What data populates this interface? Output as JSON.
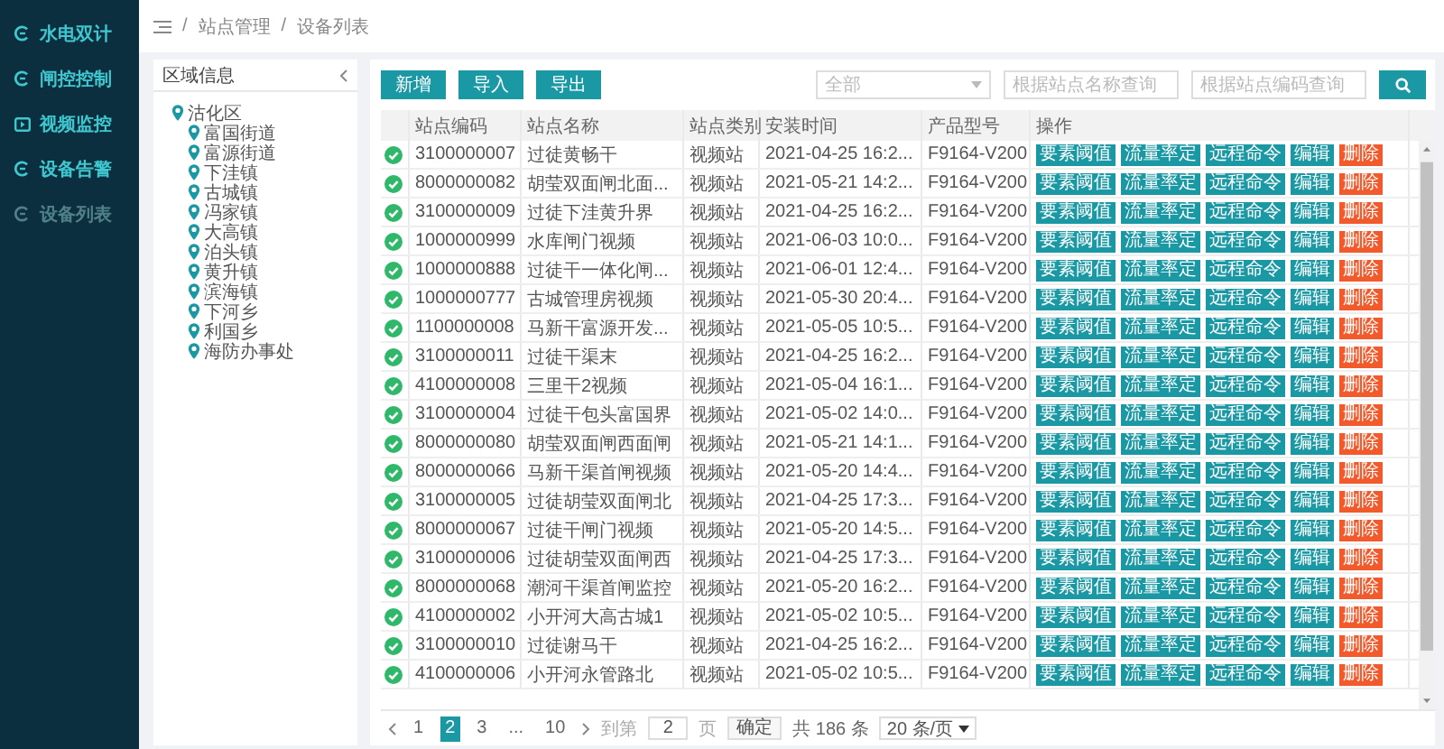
{
  "sidebar": {
    "items": [
      {
        "label": "水电双计",
        "selected": false
      },
      {
        "label": "闸控控制",
        "selected": false
      },
      {
        "label": "视频监控",
        "selected": false
      },
      {
        "label": "设备告警",
        "selected": false
      },
      {
        "label": "设备列表",
        "selected": true
      }
    ]
  },
  "breadcrumb": [
    {
      "separator": "/",
      "label": "站点管理"
    },
    {
      "separator": "/",
      "label": "设备列表"
    }
  ],
  "region_panel": {
    "title": "区域信息",
    "tree": [
      {
        "label": "沽化区",
        "children": [
          {
            "label": "富国街道"
          },
          {
            "label": "富源街道"
          },
          {
            "label": "下洼镇"
          },
          {
            "label": "古城镇"
          },
          {
            "label": "冯家镇"
          },
          {
            "label": "大高镇"
          },
          {
            "label": "泊头镇"
          },
          {
            "label": "黄升镇"
          },
          {
            "label": "滨海镇"
          },
          {
            "label": "下河乡"
          },
          {
            "label": "利国乡"
          },
          {
            "label": "海防办事处"
          }
        ]
      }
    ]
  },
  "toolbar": {
    "buttons": [
      "新增",
      "导入",
      "导出"
    ],
    "type_select": {
      "placeholder": "全部"
    },
    "name_search": {
      "placeholder": "根据站点名称查询"
    },
    "code_search": {
      "placeholder": "根据站点编码查询"
    }
  },
  "table": {
    "columns": [
      "站点编码",
      "站点名称",
      "站点类别",
      "安装时间",
      "产品型号",
      "操作"
    ],
    "rows": [
      {
        "online": true,
        "cells": [
          "3100000007",
          "过徒黄畅干",
          "视频站",
          "2021-04-25 16:2...",
          "F9164-V200"
        ],
        "actions": [
          {
            "label": "要素阈值",
            "kind": "normal"
          },
          {
            "label": "流量率定",
            "kind": "normal"
          },
          {
            "label": "远程命令",
            "kind": "normal"
          },
          {
            "label": "编辑",
            "kind": "normal"
          },
          {
            "label": "删除",
            "kind": "danger"
          }
        ]
      },
      {
        "online": true,
        "cells": [
          "8000000082",
          "胡莹双面闸北面...",
          "视频站",
          "2021-05-21 14:2...",
          "F9164-V200"
        ],
        "actions": [
          {
            "label": "要素阈值",
            "kind": "normal"
          },
          {
            "label": "流量率定",
            "kind": "normal"
          },
          {
            "label": "远程命令",
            "kind": "normal"
          },
          {
            "label": "编辑",
            "kind": "normal"
          },
          {
            "label": "删除",
            "kind": "danger"
          }
        ]
      },
      {
        "online": true,
        "cells": [
          "3100000009",
          "过徒下洼黄升界",
          "视频站",
          "2021-04-25 16:2...",
          "F9164-V200"
        ],
        "actions": [
          {
            "label": "要素阈值",
            "kind": "normal"
          },
          {
            "label": "流量率定",
            "kind": "normal"
          },
          {
            "label": "远程命令",
            "kind": "normal"
          },
          {
            "label": "编辑",
            "kind": "normal"
          },
          {
            "label": "删除",
            "kind": "danger"
          }
        ]
      },
      {
        "online": true,
        "cells": [
          "1000000999",
          "水库闸门视频",
          "视频站",
          "2021-06-03 10:0...",
          "F9164-V200"
        ],
        "actions": [
          {
            "label": "要素阈值",
            "kind": "normal"
          },
          {
            "label": "流量率定",
            "kind": "normal"
          },
          {
            "label": "远程命令",
            "kind": "normal"
          },
          {
            "label": "编辑",
            "kind": "normal"
          },
          {
            "label": "删除",
            "kind": "danger"
          }
        ]
      },
      {
        "online": true,
        "cells": [
          "1000000888",
          "过徒干一体化闸...",
          "视频站",
          "2021-06-01 12:4...",
          "F9164-V200"
        ],
        "actions": [
          {
            "label": "要素阈值",
            "kind": "normal"
          },
          {
            "label": "流量率定",
            "kind": "normal"
          },
          {
            "label": "远程命令",
            "kind": "normal"
          },
          {
            "label": "编辑",
            "kind": "normal"
          },
          {
            "label": "删除",
            "kind": "danger"
          }
        ]
      },
      {
        "online": true,
        "cells": [
          "1000000777",
          "古城管理房视频",
          "视频站",
          "2021-05-30 20:4...",
          "F9164-V200"
        ],
        "actions": [
          {
            "label": "要素阈值",
            "kind": "normal"
          },
          {
            "label": "流量率定",
            "kind": "normal"
          },
          {
            "label": "远程命令",
            "kind": "normal"
          },
          {
            "label": "编辑",
            "kind": "normal"
          },
          {
            "label": "删除",
            "kind": "danger"
          }
        ]
      },
      {
        "online": true,
        "cells": [
          "1100000008",
          "马新干富源开发...",
          "视频站",
          "2021-05-05 10:5...",
          "F9164-V200"
        ],
        "actions": [
          {
            "label": "要素阈值",
            "kind": "normal"
          },
          {
            "label": "流量率定",
            "kind": "normal"
          },
          {
            "label": "远程命令",
            "kind": "normal"
          },
          {
            "label": "编辑",
            "kind": "normal"
          },
          {
            "label": "删除",
            "kind": "danger"
          }
        ]
      },
      {
        "online": true,
        "cells": [
          "3100000011",
          "过徒干渠末",
          "视频站",
          "2021-04-25 16:2...",
          "F9164-V200"
        ],
        "actions": [
          {
            "label": "要素阈值",
            "kind": "normal"
          },
          {
            "label": "流量率定",
            "kind": "normal"
          },
          {
            "label": "远程命令",
            "kind": "normal"
          },
          {
            "label": "编辑",
            "kind": "normal"
          },
          {
            "label": "删除",
            "kind": "danger"
          }
        ]
      },
      {
        "online": true,
        "cells": [
          "4100000008",
          "三里干2视频",
          "视频站",
          "2021-05-04 16:1...",
          "F9164-V200"
        ],
        "actions": [
          {
            "label": "要素阈值",
            "kind": "normal"
          },
          {
            "label": "流量率定",
            "kind": "normal"
          },
          {
            "label": "远程命令",
            "kind": "normal"
          },
          {
            "label": "编辑",
            "kind": "normal"
          },
          {
            "label": "删除",
            "kind": "danger"
          }
        ]
      },
      {
        "online": true,
        "cells": [
          "3100000004",
          "过徒干包头富国界",
          "视频站",
          "2021-05-02 14:0...",
          "F9164-V200"
        ],
        "actions": [
          {
            "label": "要素阈值",
            "kind": "normal"
          },
          {
            "label": "流量率定",
            "kind": "normal"
          },
          {
            "label": "远程命令",
            "kind": "normal"
          },
          {
            "label": "编辑",
            "kind": "normal"
          },
          {
            "label": "删除",
            "kind": "danger"
          }
        ]
      },
      {
        "online": true,
        "cells": [
          "8000000080",
          "胡莹双面闸西面闸",
          "视频站",
          "2021-05-21 14:1...",
          "F9164-V200"
        ],
        "actions": [
          {
            "label": "要素阈值",
            "kind": "normal"
          },
          {
            "label": "流量率定",
            "kind": "normal"
          },
          {
            "label": "远程命令",
            "kind": "normal"
          },
          {
            "label": "编辑",
            "kind": "normal"
          },
          {
            "label": "删除",
            "kind": "danger"
          }
        ]
      },
      {
        "online": true,
        "cells": [
          "8000000066",
          "马新干渠首闸视频",
          "视频站",
          "2021-05-20 14:4...",
          "F9164-V200"
        ],
        "actions": [
          {
            "label": "要素阈值",
            "kind": "normal"
          },
          {
            "label": "流量率定",
            "kind": "normal"
          },
          {
            "label": "远程命令",
            "kind": "normal"
          },
          {
            "label": "编辑",
            "kind": "normal"
          },
          {
            "label": "删除",
            "kind": "danger"
          }
        ]
      },
      {
        "online": true,
        "cells": [
          "3100000005",
          "过徒胡莹双面闸北",
          "视频站",
          "2021-04-25 17:3...",
          "F9164-V200"
        ],
        "actions": [
          {
            "label": "要素阈值",
            "kind": "normal"
          },
          {
            "label": "流量率定",
            "kind": "normal"
          },
          {
            "label": "远程命令",
            "kind": "normal"
          },
          {
            "label": "编辑",
            "kind": "normal"
          },
          {
            "label": "删除",
            "kind": "danger"
          }
        ]
      },
      {
        "online": true,
        "cells": [
          "8000000067",
          "过徒干闸门视频",
          "视频站",
          "2021-05-20 14:5...",
          "F9164-V200"
        ],
        "actions": [
          {
            "label": "要素阈值",
            "kind": "normal"
          },
          {
            "label": "流量率定",
            "kind": "normal"
          },
          {
            "label": "远程命令",
            "kind": "normal"
          },
          {
            "label": "编辑",
            "kind": "normal"
          },
          {
            "label": "删除",
            "kind": "danger"
          }
        ]
      },
      {
        "online": true,
        "cells": [
          "3100000006",
          "过徒胡莹双面闸西",
          "视频站",
          "2021-04-25 17:3...",
          "F9164-V200"
        ],
        "actions": [
          {
            "label": "要素阈值",
            "kind": "normal"
          },
          {
            "label": "流量率定",
            "kind": "normal"
          },
          {
            "label": "远程命令",
            "kind": "normal"
          },
          {
            "label": "编辑",
            "kind": "normal"
          },
          {
            "label": "删除",
            "kind": "danger"
          }
        ]
      },
      {
        "online": true,
        "cells": [
          "8000000068",
          "潮河干渠首闸监控",
          "视频站",
          "2021-05-20 16:2...",
          "F9164-V200"
        ],
        "actions": [
          {
            "label": "要素阈值",
            "kind": "normal"
          },
          {
            "label": "流量率定",
            "kind": "normal"
          },
          {
            "label": "远程命令",
            "kind": "normal"
          },
          {
            "label": "编辑",
            "kind": "normal"
          },
          {
            "label": "删除",
            "kind": "danger"
          }
        ]
      },
      {
        "online": true,
        "cells": [
          "4100000002",
          "小开河大高古城1",
          "视频站",
          "2021-05-02 10:5...",
          "F9164-V200"
        ],
        "actions": [
          {
            "label": "要素阈值",
            "kind": "normal"
          },
          {
            "label": "流量率定",
            "kind": "normal"
          },
          {
            "label": "远程命令",
            "kind": "normal"
          },
          {
            "label": "编辑",
            "kind": "normal"
          },
          {
            "label": "删除",
            "kind": "danger"
          }
        ]
      },
      {
        "online": true,
        "cells": [
          "3100000010",
          "过徒谢马干",
          "视频站",
          "2021-04-25 16:2...",
          "F9164-V200"
        ],
        "actions": [
          {
            "label": "要素阈值",
            "kind": "normal"
          },
          {
            "label": "流量率定",
            "kind": "normal"
          },
          {
            "label": "远程命令",
            "kind": "normal"
          },
          {
            "label": "编辑",
            "kind": "normal"
          },
          {
            "label": "删除",
            "kind": "danger"
          }
        ]
      },
      {
        "online": true,
        "cells": [
          "4100000006",
          "小开河永管路北",
          "视频站",
          "2021-05-02 10:5...",
          "F9164-V200"
        ],
        "actions": [
          {
            "label": "要素阈值",
            "kind": "normal"
          },
          {
            "label": "流量率定",
            "kind": "normal"
          },
          {
            "label": "远程命令",
            "kind": "normal"
          },
          {
            "label": "编辑",
            "kind": "normal"
          },
          {
            "label": "删除",
            "kind": "danger"
          }
        ]
      }
    ]
  },
  "pagination": {
    "pages": [
      {
        "label": "1",
        "selected": false
      },
      {
        "label": "2",
        "selected": true
      },
      {
        "label": "3",
        "selected": false
      },
      {
        "label": "...",
        "selected": false
      },
      {
        "label": "10",
        "selected": false
      }
    ],
    "goto_label": "到第",
    "goto_value": "2",
    "page_unit": "页",
    "confirm": "确定",
    "total": "共 186 条",
    "page_size": "20 条/页"
  }
}
